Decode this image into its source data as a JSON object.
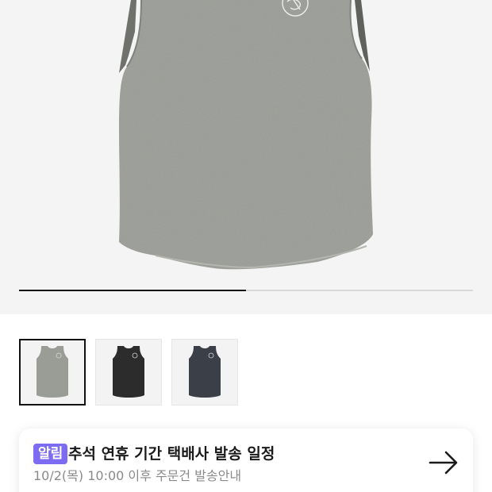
{
  "product": {
    "main_image": "sleeveless-top-gray",
    "gallery_progress_fraction": 0.5,
    "thumbnails": [
      {
        "icon": "sleeveless-top-gray",
        "color": "#9a9c96",
        "selected": true
      },
      {
        "icon": "sleeveless-top-black",
        "color": "#2c2c2c",
        "selected": false
      },
      {
        "icon": "sleeveless-top-navy",
        "color": "#3a3f48",
        "selected": false
      }
    ]
  },
  "notice": {
    "badge": "알림",
    "title": "추석 연휴 기간 택배사 발송 일정",
    "subtitle": "10/2(목) 10:00 이후 주문건 발송안내",
    "arrow_icon": "arrow-right-icon",
    "badge_color": "#7b6cf2"
  }
}
